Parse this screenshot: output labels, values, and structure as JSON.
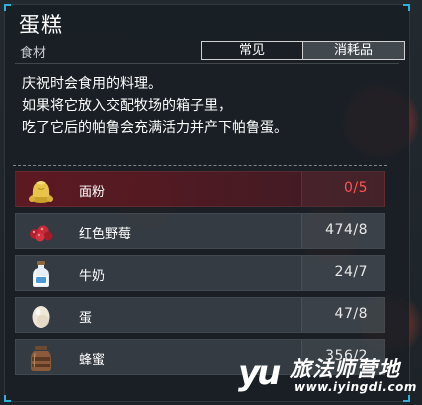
{
  "item": {
    "title": "蛋糕",
    "category": "食材"
  },
  "tabs": [
    {
      "label": "常见",
      "active": false
    },
    {
      "label": "消耗品",
      "active": true
    }
  ],
  "description": [
    "庆祝时会食用的料理。",
    "如果将它放入交配牧场的箱子里，",
    "吃了它后的帕鲁会充满活力并产下帕鲁蛋。"
  ],
  "ingredients": [
    {
      "name": "面粉",
      "count": "0/5",
      "icon": "flour-sack-icon",
      "insufficient": true
    },
    {
      "name": "红色野莓",
      "count": "474/8",
      "icon": "red-berries-icon",
      "insufficient": false
    },
    {
      "name": "牛奶",
      "count": "24/7",
      "icon": "milk-bottle-icon",
      "insufficient": false
    },
    {
      "name": "蛋",
      "count": "47/8",
      "icon": "egg-icon",
      "insufficient": false
    },
    {
      "name": "蜂蜜",
      "count": "356/2",
      "icon": "honey-jar-icon",
      "insufficient": false
    }
  ],
  "watermark": {
    "logo": "yu",
    "name": "旅法师营地",
    "url": "www.iyingdi.com"
  },
  "colors": {
    "accent": "#2fb0d8",
    "insufficient": "#ff5454"
  }
}
